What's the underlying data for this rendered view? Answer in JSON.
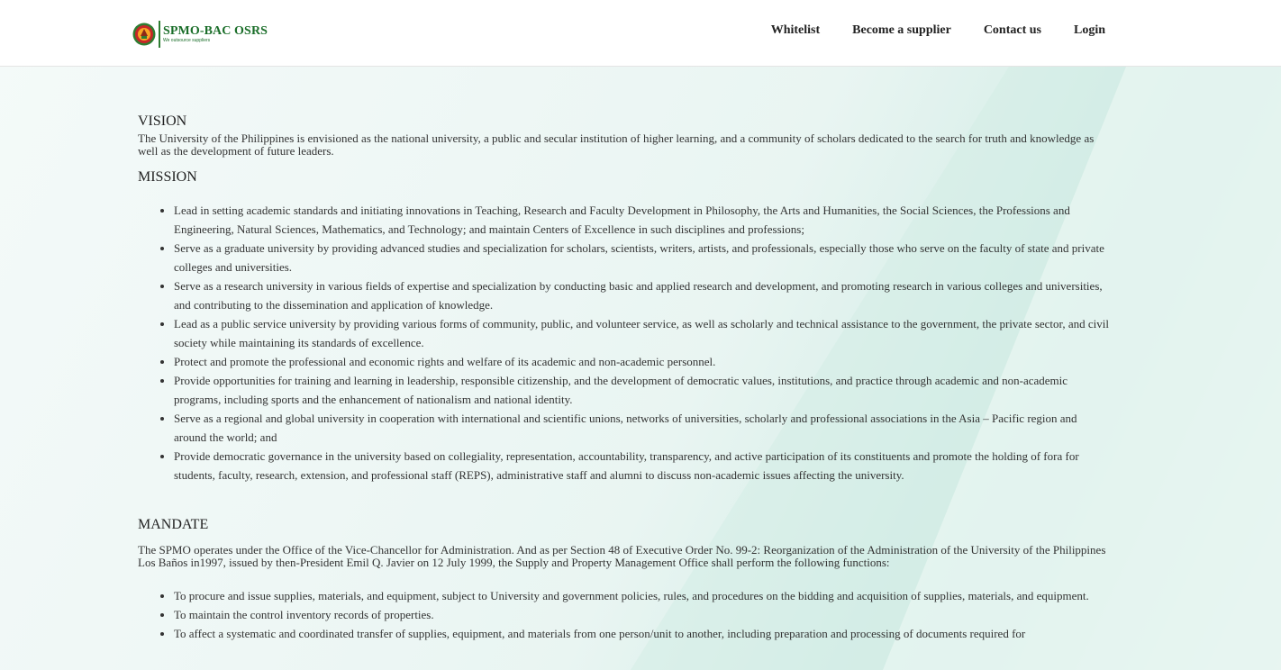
{
  "header": {
    "brand": {
      "title": "SPMO-BAC OSRS",
      "tagline": "We outsource suppliers"
    },
    "nav": [
      "Whitelist",
      "Become a supplier",
      "Contact us",
      "Login"
    ]
  },
  "vision": {
    "heading": "VISION",
    "text": "The University of the Philippines is envisioned as the national university, a public and secular institution of higher learning, and a community of scholars dedicated to the search for truth and knowledge as well as the development of future leaders."
  },
  "mission": {
    "heading": "MISSION",
    "items": [
      "Lead in setting academic standards and initiating innovations in Teaching, Research and Faculty Development in Philosophy, the Arts and Humanities, the Social Sciences, the Professions and Engineering, Natural Sciences, Mathematics, and Technology; and maintain Centers of Excellence in such disciplines and professions;",
      "Serve as a graduate university by providing advanced studies and specialization for scholars, scientists, writers, artists, and professionals, especially those who serve on the faculty of state and private colleges and universities.",
      "Serve as a research university in various fields of expertise and specialization by conducting basic and applied research and development, and promoting research in various colleges and universities, and contributing to the dissemination and application of knowledge.",
      "Lead as a public service university by providing various forms of community, public, and volunteer service, as well as scholarly and technical assistance to the government, the private sector, and civil society while maintaining its standards of excellence.",
      "Protect and promote the professional and economic rights and welfare of its academic and non-academic personnel.",
      "Provide opportunities for training and learning in leadership, responsible citizenship, and the development of democratic values, institutions, and practice through academic and non-academic programs, including sports and the enhancement of nationalism and national identity.",
      "Serve as a regional and global university in cooperation with international and scientific unions, networks of universities, scholarly and professional associations in the Asia – Pacific region and around the world; and",
      "Provide democratic governance in the university based on collegiality, representation, accountability, transparency, and active participation of its constituents and promote the holding of fora for students, faculty, research, extension, and professional staff (REPS), administrative staff and alumni to discuss non-academic issues affecting the university."
    ]
  },
  "mandate": {
    "heading": "MANDATE",
    "text": "The SPMO operates under the Office of the Vice-Chancellor for Administration.  And as per Section 48 of Executive Order No. 99-2: Reorganization of the Administration of the University of the Philippines Los Baños in1997, issued by then-President Emil Q. Javier on 12 July 1999, the Supply and Property Management Office shall perform the following functions:",
    "items": [
      "To procure and issue supplies, materials, and equipment, subject to University and government policies, rules, and procedures on the bidding and acquisition of supplies, materials, and equipment.",
      "To maintain the control inventory records of properties.",
      "To affect a systematic and coordinated transfer of supplies, equipment, and materials from one person/unit to another, including preparation and processing of documents required for"
    ]
  },
  "colors": {
    "brand_green": "#1b6e2a",
    "background_tint": "#d6eee8"
  }
}
